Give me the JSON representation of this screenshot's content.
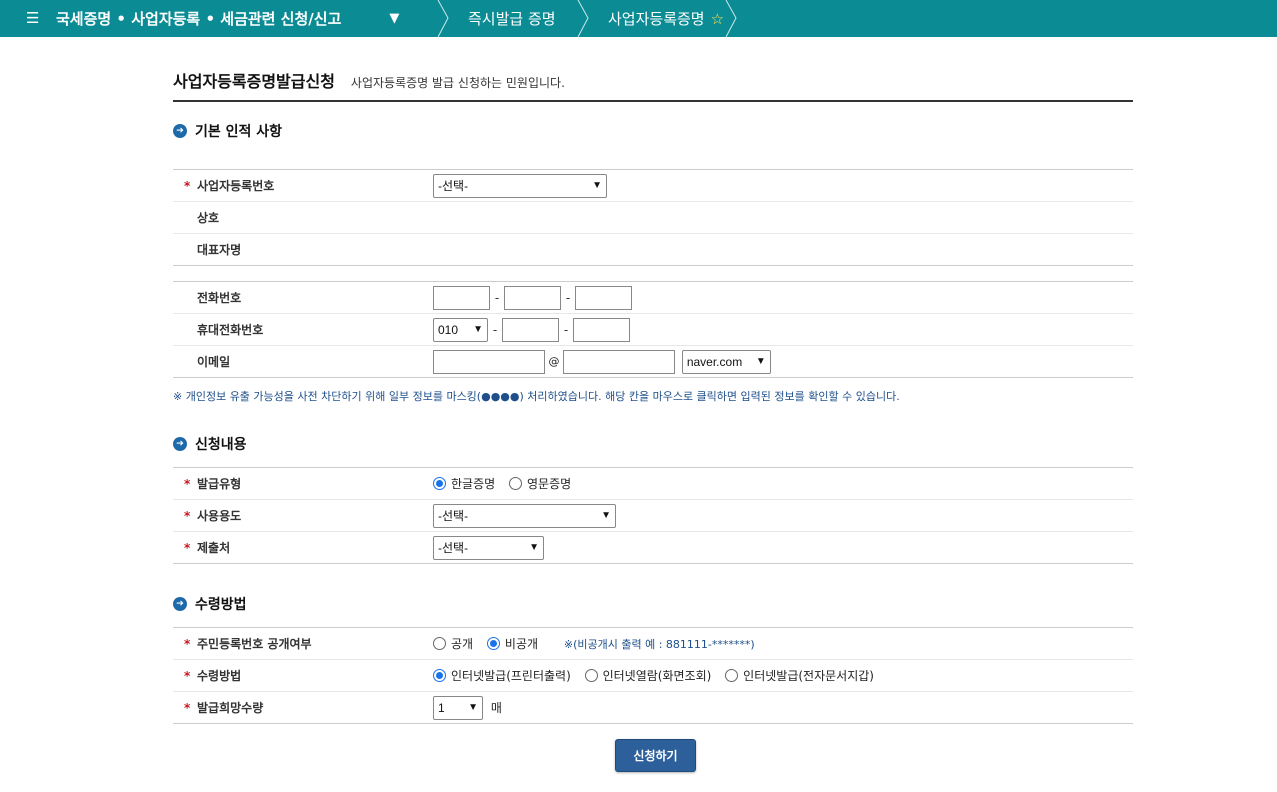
{
  "nav": {
    "main": "국세증명 • 사업자등록 • 세금관련 신청/신고",
    "crumb2": "즉시발급 증명",
    "crumb3": "사업자등록증명"
  },
  "page": {
    "title": "사업자등록증명발급신청",
    "desc": "사업자등록증명 발급 신청하는 민원입니다."
  },
  "basic": {
    "title": "기본 인적 사항",
    "biz_no_label": "사업자등록번호",
    "biz_no_value": "-선택-",
    "name_label": "상호",
    "rep_label": "대표자명",
    "phone_label": "전화번호",
    "mobile_label": "휴대전화번호",
    "mobile_prefix": "010",
    "email_label": "이메일",
    "email_domain": "naver.com",
    "at": "@",
    "dash": "-",
    "privacy_note": "※ 개인정보 유출 가능성을 사전 차단하기 위해 일부 정보를 마스킹(●●●●) 처리하였습니다. 해당 칸을 마우스로 클릭하면 입력된 정보를 확인할 수 있습니다."
  },
  "request": {
    "title": "신청내용",
    "type_label": "발급유형",
    "type_opt1": "한글증명",
    "type_opt2": "영문증명",
    "purpose_label": "사용용도",
    "purpose_value": "-선택-",
    "submit_to_label": "제출처",
    "submit_to_value": "-선택-"
  },
  "receive": {
    "title": "수령방법",
    "rrn_label": "주민등록번호 공개여부",
    "rrn_opt1": "공개",
    "rrn_opt2": "비공개",
    "rrn_note": "※(비공개시 출력 예 : 881111-*******)",
    "method_label": "수령방법",
    "method_opt1": "인터넷발급(프린터출력)",
    "method_opt2": "인터넷열람(화면조회)",
    "method_opt3": "인터넷발급(전자문서지갑)",
    "qty_label": "발급희망수량",
    "qty_value": "1",
    "qty_unit": "매"
  },
  "submit_label": "신청하기",
  "colors": {
    "topbar": "#0b8c94",
    "button": "#2d5f9a",
    "required": "#c4161c"
  }
}
